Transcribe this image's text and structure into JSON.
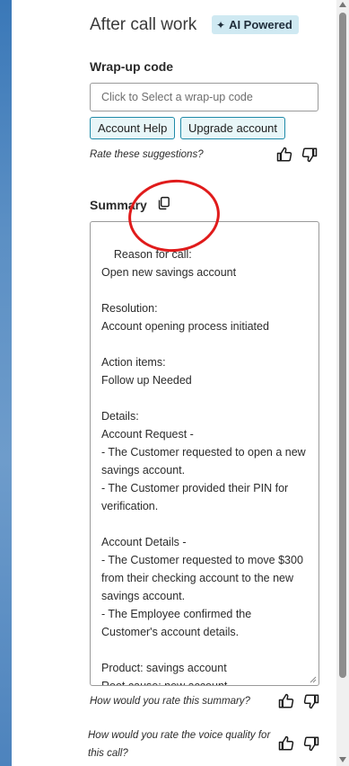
{
  "header": {
    "title": "After call work",
    "ai_badge": "AI Powered"
  },
  "wrapup": {
    "label": "Wrap-up code",
    "placeholder": "Click to Select a wrap-up code",
    "suggestions": [
      "Account Help",
      "Upgrade account"
    ],
    "rate_prompt": "Rate these suggestions?"
  },
  "summary": {
    "label": "Summary",
    "text": "Reason for call:\nOpen new savings account\n\nResolution:\nAccount opening process initiated\n\nAction items:\nFollow up Needed\n\nDetails:\nAccount Request -\n- The Customer requested to open a new savings account.\n- The Customer provided their PIN for verification.\n\nAccount Details -\n- The Customer requested to move $300 from their checking account to the new savings account.\n- The Employee confirmed the Customer's account details.\n\nProduct: savings account\nRoot cause: new account",
    "rate_prompt": "How would you rate this summary?"
  },
  "voice_quality": {
    "rate_prompt": "How would you rate the voice quality for this call?"
  },
  "icons": {
    "thumbs_up": "thumbs-up-icon",
    "thumbs_down": "thumbs-down-icon",
    "copy": "copy-icon",
    "sparkle": "sparkle-icon"
  },
  "colors": {
    "badge_bg": "#cfe9f2",
    "chip_border": "#1f8aa8",
    "chip_bg": "#e8f6f8",
    "annotation": "#e01b1b"
  }
}
